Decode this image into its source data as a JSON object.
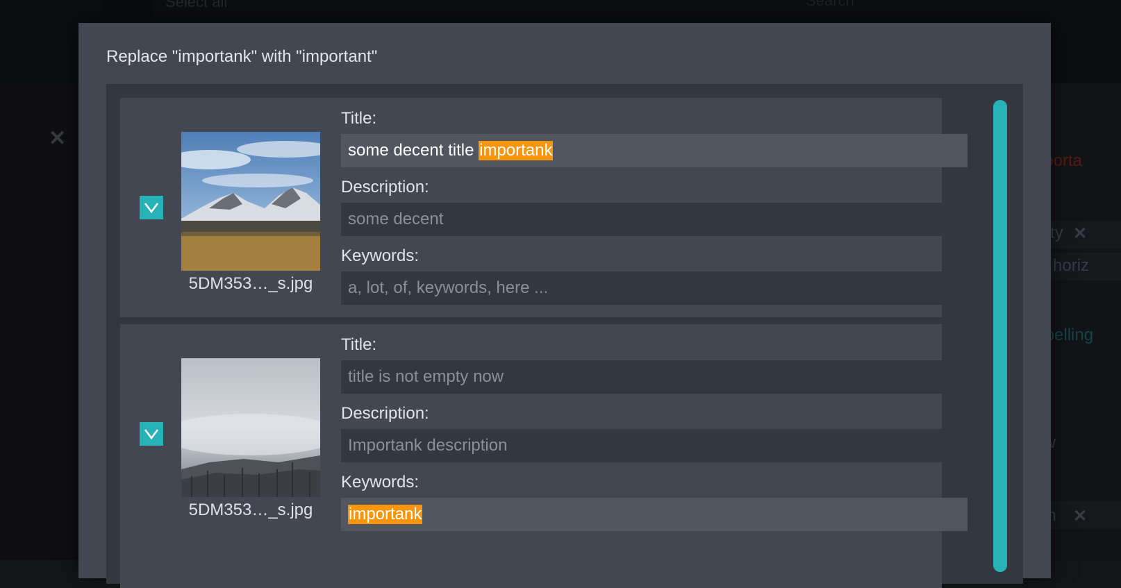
{
  "background": {
    "select_all": "Select all",
    "search_label": "Search",
    "right_texts": [
      "importa",
      "eauty",
      "horiz",
      "k spelling",
      "now",
      "sun"
    ]
  },
  "dialog": {
    "title": "Replace \"importank\" with \"important\"",
    "items": [
      {
        "checked": true,
        "filename": "5DM353…_s.jpg",
        "title_label": "Title:",
        "title_prefix": "some decent title ",
        "title_match": "importank",
        "description_label": "Description:",
        "description_value": "some decent",
        "keywords_label": "Keywords:",
        "keywords_placeholder": "a, lot, of, keywords, here ..."
      },
      {
        "checked": true,
        "filename": "5DM353…_s.jpg",
        "title_label": "Title:",
        "title_value": "title is not empty now",
        "description_label": "Description:",
        "description_value": "Importank description",
        "keywords_label": "Keywords:",
        "keywords_match": "importank"
      }
    ]
  },
  "colors": {
    "accent": "#27b2b8",
    "highlight": "#f7960e",
    "dialog_bg": "#434752",
    "list_bg": "#333740"
  }
}
